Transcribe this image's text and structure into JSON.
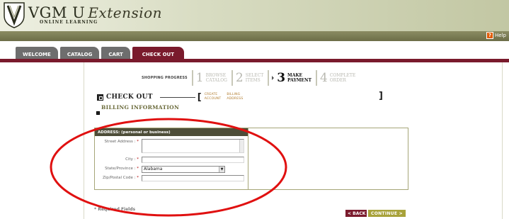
{
  "brand": {
    "name": "VGM U",
    "script": "Extension",
    "tagline": "ONLINE LEARNING"
  },
  "help": {
    "label": "Help"
  },
  "tabs": [
    {
      "label": "WELCOME"
    },
    {
      "label": "CATALOG"
    },
    {
      "label": "CART"
    },
    {
      "label": "CHECK OUT",
      "active": true
    }
  ],
  "progress": {
    "label": "SHOPPING PROGRESS",
    "steps": [
      {
        "num": "1",
        "line1": "BROWSE",
        "line2": "CATALOG"
      },
      {
        "num": "2",
        "line1": "SELECT",
        "line2": "ITEMS"
      },
      {
        "num": "3",
        "line1": "MAKE",
        "line2": "PAYMENT",
        "active": true
      },
      {
        "num": "4",
        "line1": "COMPLETE",
        "line2": "ORDER"
      }
    ]
  },
  "checkout": {
    "title": "CHECK OUT",
    "substeps": [
      {
        "line1": "CREATE",
        "line2": "ACCOUNT"
      },
      {
        "line1": "BILLING",
        "line2": "ADDRESS"
      }
    ]
  },
  "billing": {
    "title": "BILLING INFORMATION"
  },
  "address": {
    "header": "ADDRESS: (personal or business)",
    "street_label": "Street Address :",
    "city_label": "City :",
    "state_label": "State/Province :",
    "state_value": "Alabama",
    "zip_label": "Zip/Postal Code :",
    "required_marker": "*"
  },
  "footer": {
    "required_note": "* Required Fields",
    "back": "< BACK",
    "continue": "CONTINUE >"
  },
  "colors": {
    "accent": "#7a1a2c",
    "continue": "#a8a23a",
    "highlight_ellipse": "#e01010"
  }
}
